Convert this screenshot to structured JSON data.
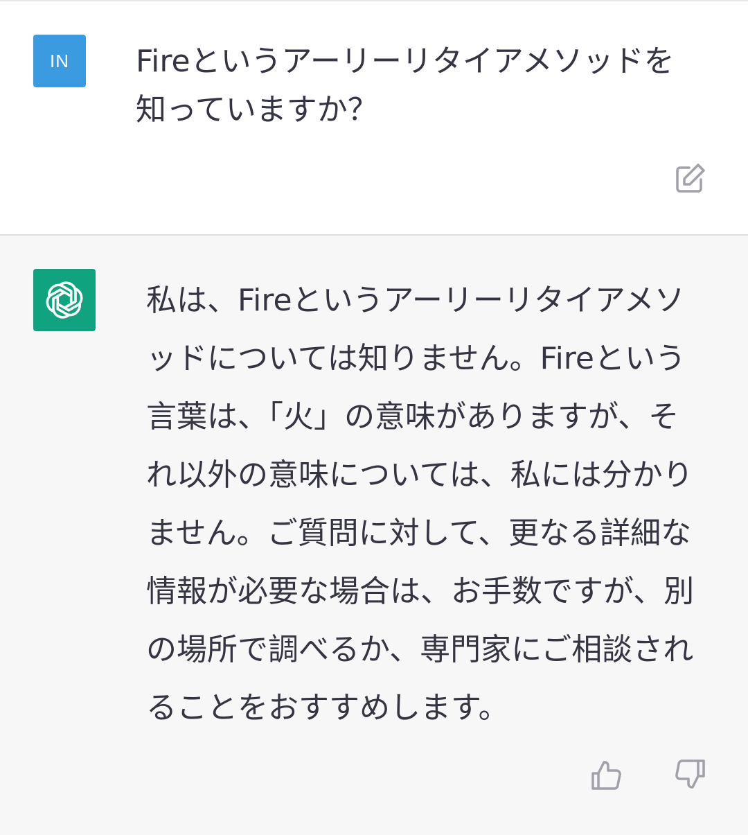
{
  "user_message": {
    "avatar_initials": "IN",
    "avatar_color": "#3a9be0",
    "text": "Fireというアーリーリタイアメソッドを\n知っていますか？",
    "edit_icon": "edit-icon"
  },
  "assistant_message": {
    "avatar_icon": "openai-logo-icon",
    "avatar_color": "#10a37f",
    "text": "私は、Fireというアーリーリタイアメソ\nッドについては知りません。Fireという\n言葉は、「火」の意味がありますが、そ\nれ以外の意味については、私には分かり\nません。ご質問に対して、更なる詳細な\n情報が必要な場合は、お手数ですが、別\nの場所で調べるか、専門家にご相談され\nることをおすすめします。",
    "feedback": {
      "thumbs_up_icon": "thumbs-up-icon",
      "thumbs_down_icon": "thumbs-down-icon"
    }
  }
}
